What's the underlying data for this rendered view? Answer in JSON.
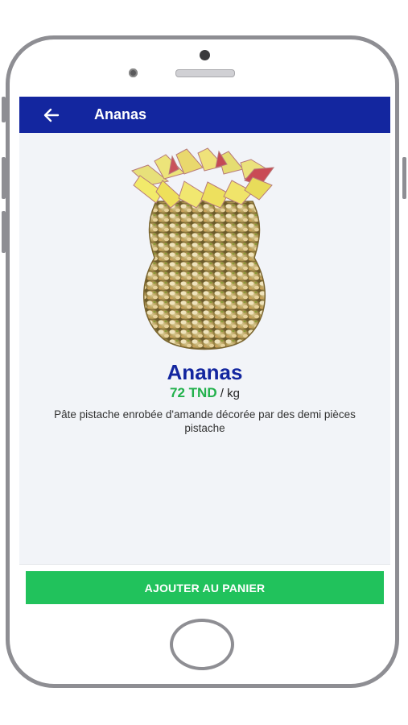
{
  "app_bar": {
    "back_icon": "arrow-left-icon",
    "title": "Ananas",
    "background": "#13269f"
  },
  "product": {
    "image_icon": "pineapple-sweet-image",
    "name": "Ananas",
    "price": "72 TND",
    "unit": "/ kg",
    "description": "Pâte pistache enrobée d'amande décorée par des demi pièces pistache",
    "name_color": "#13269f",
    "price_color": "#22b14c"
  },
  "actions": {
    "add_to_cart_label": "AJOUTER AU PANIER",
    "button_color": "#21c25c"
  }
}
